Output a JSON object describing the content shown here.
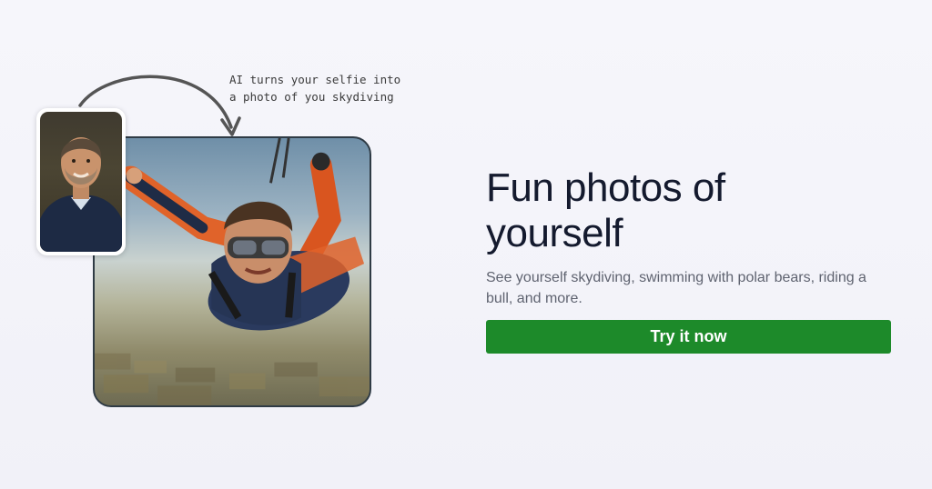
{
  "illustration": {
    "caption_line1": "AI turns your selfie into",
    "caption_line2": "a photo of you skydiving",
    "selfie_image": "selfie-portrait",
    "result_image": "skydiving-photo",
    "arrow_icon": "curved-arrow-icon"
  },
  "hero": {
    "title_line1": "Fun photos of",
    "title_line2": "yourself",
    "subtitle": "See yourself skydiving, swimming with polar bears, riding a bull, and more.",
    "cta_label": "Try it now"
  },
  "colors": {
    "cta_background": "#1d8a2a",
    "title": "#141a2e",
    "subtitle": "#5f6370",
    "background": "#f4f4fa"
  }
}
